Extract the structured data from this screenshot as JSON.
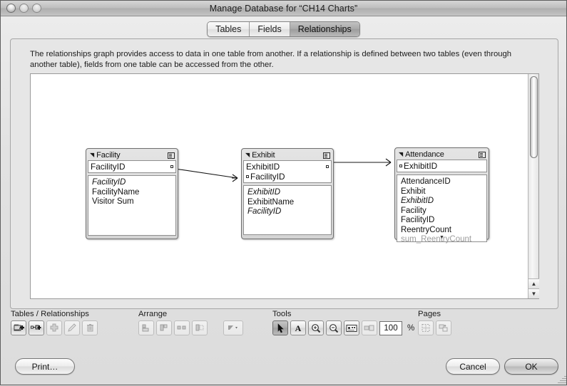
{
  "window": {
    "title": "Manage Database for “CH14 Charts”",
    "traffic_lights": [
      "close-button",
      "minimize-button",
      "zoom-button"
    ]
  },
  "tabs": [
    {
      "label": "Tables",
      "active": false
    },
    {
      "label": "Fields",
      "active": false
    },
    {
      "label": "Relationships",
      "active": true
    }
  ],
  "description": "The relationships graph provides access to data in one table from another. If a relationship is defined between two tables (even through another table), fields from one table can be accessed from the other.",
  "graph": {
    "tables": [
      {
        "name": "Facility",
        "match_fields": [
          {
            "label": "FacilityID",
            "bullet_left": false,
            "bullet_right": true
          }
        ],
        "fields": [
          {
            "label": "FacilityID",
            "italic": true,
            "dim": false
          },
          {
            "label": "FacilityName",
            "italic": false,
            "dim": false
          },
          {
            "label": "Visitor Sum",
            "italic": false,
            "dim": false
          }
        ]
      },
      {
        "name": "Exhibit",
        "match_fields": [
          {
            "label": "ExhibitID",
            "bullet_left": false,
            "bullet_right": true
          },
          {
            "label": "FacilityID",
            "bullet_left": true,
            "bullet_right": false
          }
        ],
        "fields": [
          {
            "label": "ExhibitID",
            "italic": true,
            "dim": false
          },
          {
            "label": "ExhibitName",
            "italic": false,
            "dim": false
          },
          {
            "label": "FacilityID",
            "italic": true,
            "dim": false
          }
        ]
      },
      {
        "name": "Attendance",
        "match_fields": [
          {
            "label": "ExhibitID",
            "bullet_left": true,
            "bullet_right": false
          }
        ],
        "fields": [
          {
            "label": "AttendanceID",
            "italic": false,
            "dim": false
          },
          {
            "label": "Exhibit",
            "italic": false,
            "dim": false
          },
          {
            "label": "ExhibitID",
            "italic": true,
            "dim": false
          },
          {
            "label": "Facility",
            "italic": false,
            "dim": false
          },
          {
            "label": "FacilityID",
            "italic": false,
            "dim": false
          },
          {
            "label": "ReentryCount",
            "italic": false,
            "dim": false
          },
          {
            "label": "sum_ReentryCount",
            "italic": false,
            "dim": true
          }
        ]
      }
    ],
    "relationships": [
      {
        "operator": "=",
        "from": "Facility::FacilityID",
        "to": "Exhibit::FacilityID"
      },
      {
        "operator": "=",
        "from": "Exhibit::ExhibitID",
        "to": "Attendance::ExhibitID"
      }
    ]
  },
  "toolbar": {
    "groups": [
      {
        "label": "Tables / Relationships",
        "buttons": [
          {
            "name": "add-table-button",
            "enabled": true,
            "selected": false
          },
          {
            "name": "add-relationship-button",
            "enabled": true,
            "selected": false
          },
          {
            "name": "duplicate-button",
            "enabled": false,
            "selected": false
          },
          {
            "name": "edit-button",
            "enabled": false,
            "selected": false
          },
          {
            "name": "delete-button",
            "enabled": false,
            "selected": false
          }
        ]
      },
      {
        "label": "Arrange",
        "buttons": [
          {
            "name": "align-left-button",
            "enabled": false,
            "selected": false
          },
          {
            "name": "align-top-button",
            "enabled": false,
            "selected": false
          },
          {
            "name": "distribute-horizontal-button",
            "enabled": false,
            "selected": false
          },
          {
            "name": "resize-button",
            "enabled": false,
            "selected": false
          },
          {
            "name": "color-menu-button",
            "enabled": false,
            "selected": false
          }
        ]
      },
      {
        "label": "Tools",
        "buttons": [
          {
            "name": "selection-tool-button",
            "enabled": true,
            "selected": true
          },
          {
            "name": "text-tool-button",
            "enabled": true,
            "selected": false
          },
          {
            "name": "zoom-in-tool-button",
            "enabled": true,
            "selected": false
          },
          {
            "name": "zoom-out-tool-button",
            "enabled": true,
            "selected": false
          },
          {
            "name": "fit-to-window-button",
            "enabled": true,
            "selected": false
          },
          {
            "name": "selected-objects-button",
            "enabled": false,
            "selected": false
          }
        ],
        "zoom_value": "100",
        "zoom_unit": "%"
      },
      {
        "label": "Pages",
        "buttons": [
          {
            "name": "page-breaks-button",
            "enabled": false,
            "selected": false
          },
          {
            "name": "page-setup-button",
            "enabled": false,
            "selected": false
          }
        ]
      }
    ]
  },
  "footer": {
    "print_label": "Print…",
    "cancel_label": "Cancel",
    "ok_label": "OK"
  }
}
